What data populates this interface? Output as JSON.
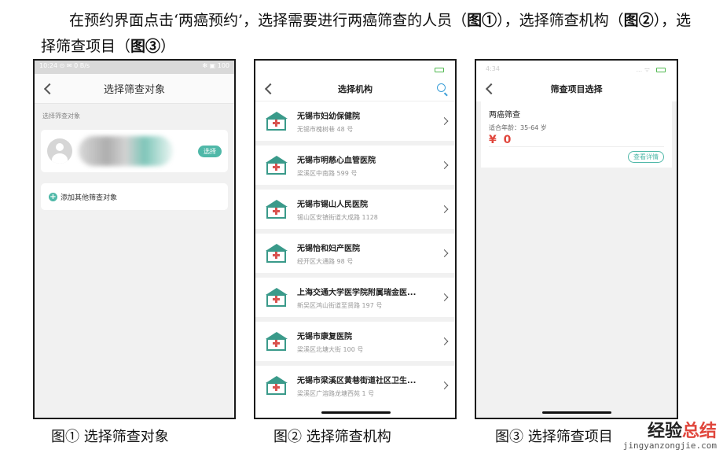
{
  "intro": {
    "part1": "在预约界面点击‘两癌预约’，选择需要进行两癌筛查的人员（",
    "ref1": "图①",
    "part2": "），选择筛查机构（",
    "ref2": "图②",
    "part3": "），选择筛查项目（",
    "ref3": "图③",
    "part4": "）"
  },
  "phone1": {
    "status_left": "10:24 ⊙ ✉ 0 B/s",
    "status_right": "✻ ▣ 100",
    "title": "选择筛查对象",
    "section_label": "选择筛查对象",
    "select_label": "选择",
    "add_label": "添加其他筛查对象",
    "plus_glyph": "+"
  },
  "phone2": {
    "title": "选择机构",
    "institutions": [
      {
        "name": "无锡市妇幼保健院",
        "address": "无锡市槐树巷 48 号"
      },
      {
        "name": "无锡市明慈心血管医院",
        "address": "梁溪区中南路 599 号"
      },
      {
        "name": "无锡市锡山人民医院",
        "address": "锡山区安镇街道大成路 1128"
      },
      {
        "name": "无锡怡和妇产医院",
        "address": "经开区大通路 98 号"
      },
      {
        "name": "上海交通大学医学院附属瑞金医...",
        "address": "新吴区鸿山街道至贤路 197 号"
      },
      {
        "name": "无锡市康复医院",
        "address": "梁溪区北塘大街 100 号"
      },
      {
        "name": "无锡市梁溪区黄巷街道社区卫生...",
        "address": "梁溪区广溶路龙塘西苑 1 号"
      }
    ]
  },
  "phone3": {
    "time": "4:34",
    "signal": "...  ᯤ",
    "title": "筛查项目选择",
    "item_name": "两癌筛查",
    "age_range": "适合年龄：35-64 岁",
    "price": "¥ 0",
    "detail_label": "查看详情"
  },
  "captions": {
    "c1": "图① 选择筛查对象",
    "c2": "图② 选择筛查机构",
    "c3": "图③ 选择筛查项目"
  },
  "watermark": {
    "text_a": "经验",
    "text_b": "总结",
    "url": "jingyanzongjie.com"
  },
  "colors": {
    "accent": "#4fb8a8",
    "price": "#e0463c",
    "search": "#3a9fd8",
    "hospital_icon": "#3a9a8a"
  }
}
